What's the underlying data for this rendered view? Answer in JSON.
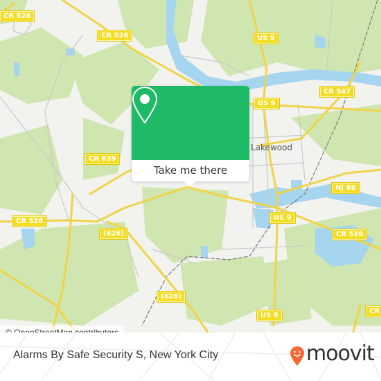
{
  "map": {
    "colors": {
      "land": "#f2f2ef",
      "forest": "#cfe6b0",
      "water": "#a6d5ef",
      "road_major": "#f4dd25",
      "road_minor": "#c9c9c9",
      "rail": "#777777"
    },
    "road_shields": [
      {
        "id": "cr526-top-left",
        "label": "CR 526"
      },
      {
        "id": "cr526",
        "label": "CR 526"
      },
      {
        "id": "us9-north",
        "label": "US 9"
      },
      {
        "id": "us9-lakewood",
        "label": "US 9"
      },
      {
        "id": "cr547",
        "label": "CR 547"
      },
      {
        "id": "cr639",
        "label": "CR 639"
      },
      {
        "id": "nj88",
        "label": "NJ 88"
      },
      {
        "id": "cr528-west",
        "label": "CR 528"
      },
      {
        "id": "626-upper",
        "label": "(626)"
      },
      {
        "id": "us9-central",
        "label": "US 9"
      },
      {
        "id": "cr528-east",
        "label": "CR 528"
      },
      {
        "id": "626-lower",
        "label": "(626)"
      },
      {
        "id": "us9-south",
        "label": "US 9"
      },
      {
        "id": "cr-southeast",
        "label": "CR"
      }
    ],
    "place_labels": [
      {
        "name": "Lakewood"
      }
    ],
    "attribution": "© OpenStreetMap contributors"
  },
  "popup": {
    "icon": "location-pin-icon",
    "button_label": "Take me there",
    "accent_color": "#1fba67"
  },
  "footer": {
    "title": "Alarms By Safe Security S, New York City",
    "logo_text": "moovit",
    "logo_color": "#f26b3a"
  }
}
